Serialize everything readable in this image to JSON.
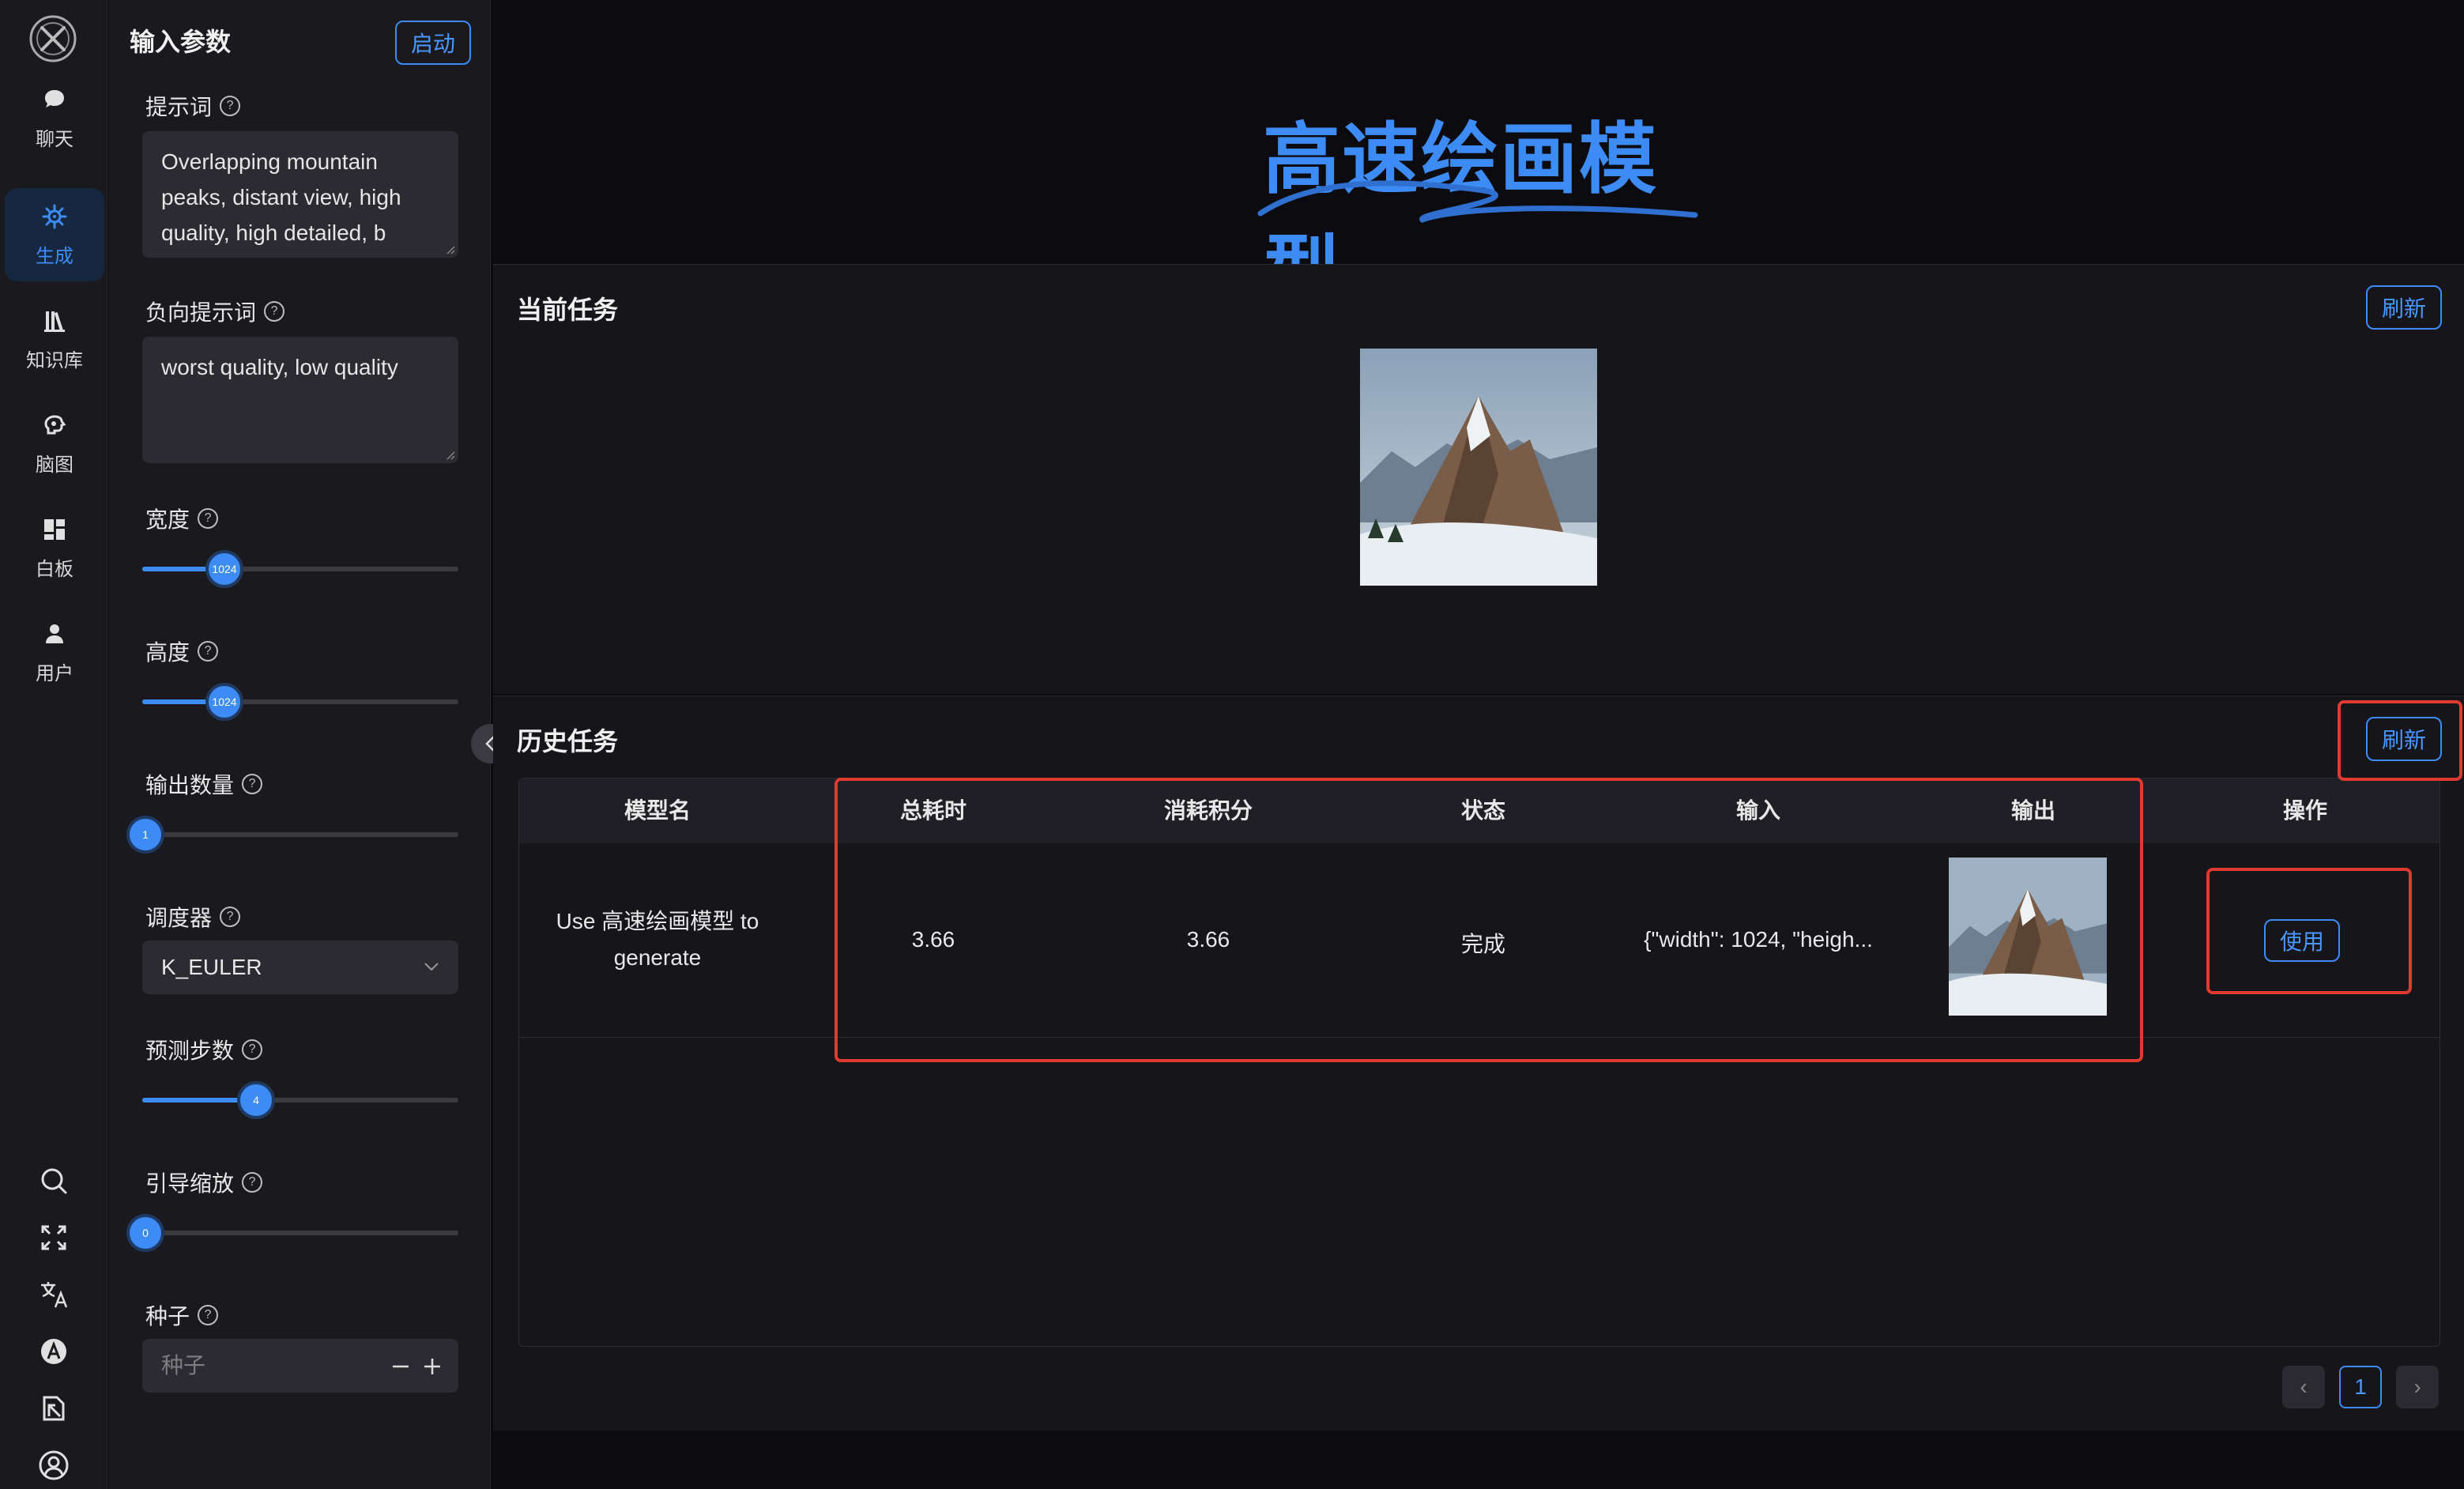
{
  "nav": {
    "items": [
      {
        "label": "聊天",
        "icon": "chat-icon"
      },
      {
        "label": "生成",
        "icon": "generate-icon",
        "active": true
      },
      {
        "label": "知识库",
        "icon": "library-icon"
      },
      {
        "label": "脑图",
        "icon": "mindmap-icon"
      },
      {
        "label": "白板",
        "icon": "whiteboard-icon"
      },
      {
        "label": "用户",
        "icon": "user-icon"
      }
    ],
    "tools": [
      "search-icon",
      "fullscreen-icon",
      "translate-icon",
      "font-icon",
      "book-icon",
      "account-icon"
    ]
  },
  "panel": {
    "title": "输入参数",
    "start_label": "启动",
    "prompt_label": "提示词",
    "prompt_value": "Overlapping mountain peaks, distant view, high quality,  high detailed, b",
    "neg_prompt_label": "负向提示词",
    "neg_prompt_value": "worst quality, low quality",
    "width_label": "宽度",
    "width_value": "1024",
    "width_fraction": 0.25,
    "height_label": "高度",
    "height_value": "1024",
    "height_fraction": 0.25,
    "count_label": "输出数量",
    "count_value": "1",
    "count_fraction": 0.0,
    "scheduler_label": "调度器",
    "scheduler_value": "K_EULER",
    "steps_label": "预测步数",
    "steps_value": "4",
    "steps_fraction": 0.35,
    "guidance_label": "引导缩放",
    "guidance_value": "0",
    "guidance_fraction": 0.0,
    "seed_label": "种子",
    "seed_placeholder": "种子",
    "help_glyph": "?"
  },
  "main": {
    "title": "高速绘画模型",
    "current": {
      "title": "当前任务",
      "refresh_label": "刷新"
    },
    "history": {
      "title": "历史任务",
      "refresh_label": "刷新",
      "columns": [
        "模型名",
        "总耗时",
        "消耗积分",
        "状态",
        "输入",
        "输出",
        "操作"
      ],
      "rows": [
        {
          "model_line1": "Use 高速绘画模型 to",
          "model_line2": "generate",
          "time": "3.66",
          "points": "3.66",
          "status": "完成",
          "input": "{\"width\": 1024, \"heigh...",
          "action": "使用"
        }
      ],
      "pagination": {
        "prev": "‹",
        "current": "1",
        "next": "›"
      }
    }
  },
  "colors": {
    "accent": "#3d8cf5",
    "highlight": "#e0392f",
    "background": "#0c0c10",
    "panel": "#19191e"
  }
}
